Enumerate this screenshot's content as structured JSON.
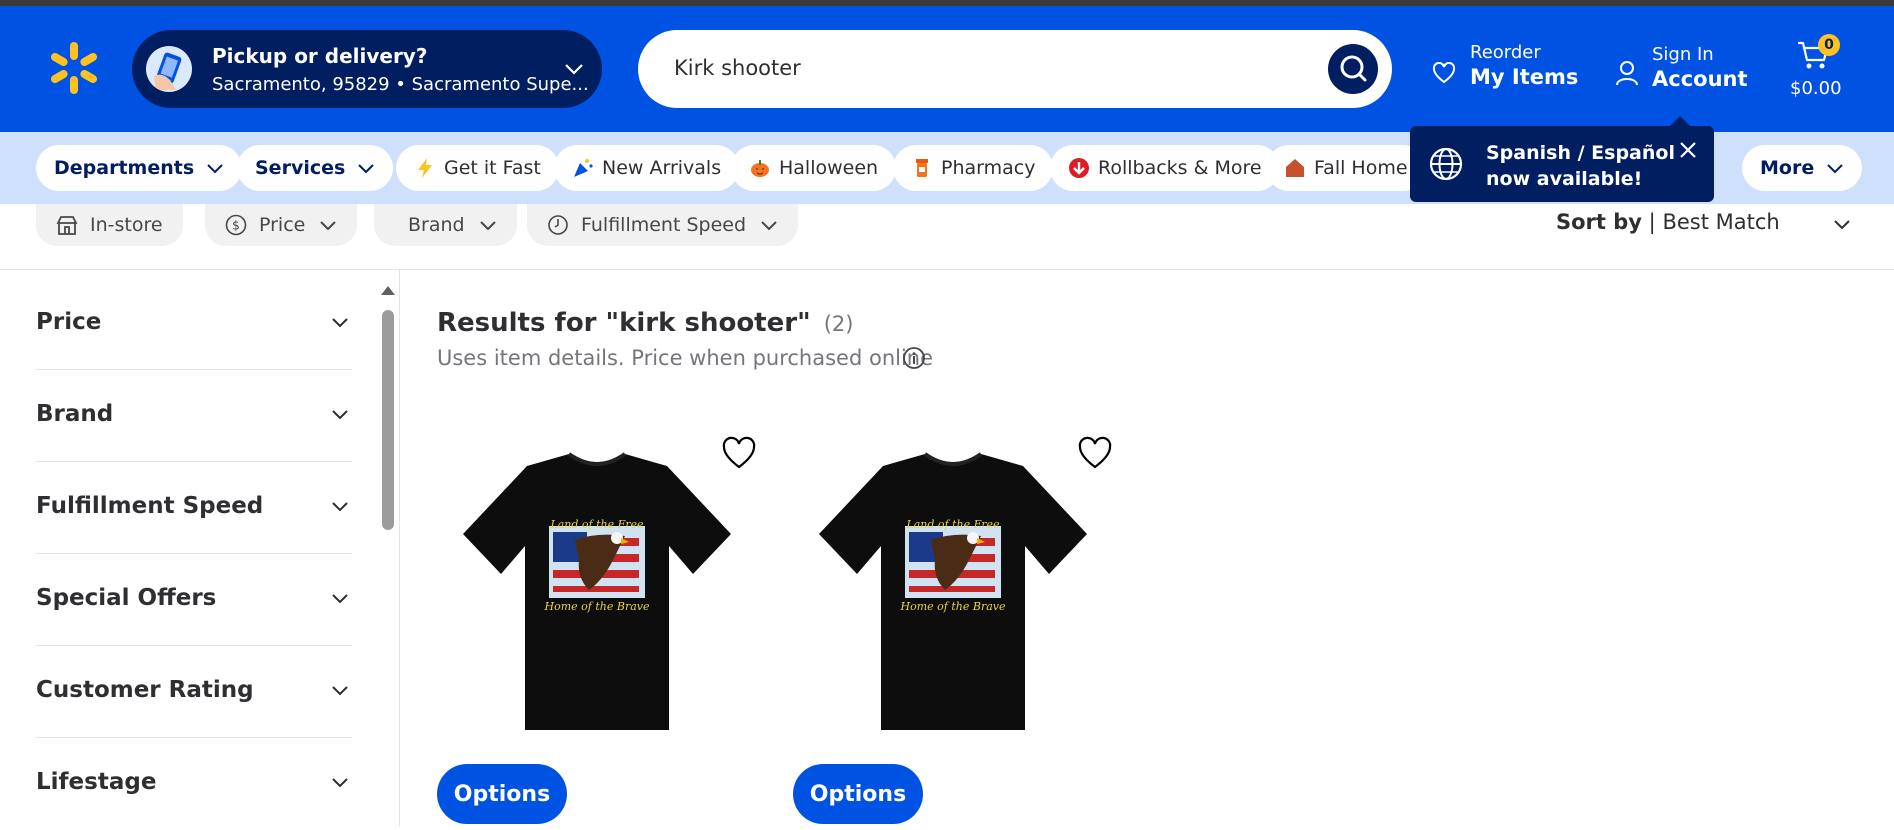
{
  "header": {
    "logo_icon": "walmart-spark-icon",
    "pickup_title": "Pickup or delivery?",
    "pickup_location": "Sacramento, 95829 • Sacramento Supe...",
    "search_value": "Kirk shooter",
    "reorder_small": "Reorder",
    "reorder_big": "My Items",
    "signin_small": "Sign In",
    "signin_big": "Account",
    "cart_count": "0",
    "cart_total": "$0.00",
    "brand_color": "#0053e2",
    "accent_color": "#ffc220"
  },
  "nav": {
    "items": [
      {
        "label": "Departments"
      },
      {
        "label": "Services"
      },
      {
        "label": "Get it Fast"
      },
      {
        "label": "New Arrivals"
      },
      {
        "label": "Halloween"
      },
      {
        "label": "Pharmacy"
      },
      {
        "label": "Rollbacks & More"
      },
      {
        "label": "Fall Home"
      },
      {
        "label": "More"
      }
    ]
  },
  "tooltip": {
    "line1": "Spanish / Español",
    "line2": "now available!"
  },
  "filters": {
    "chips": [
      {
        "label": "In-store"
      },
      {
        "label": "Price"
      },
      {
        "label": "Brand"
      },
      {
        "label": "Fulfillment Speed"
      }
    ],
    "sort_label": "Sort by",
    "sort_value": "Best Match"
  },
  "sidebar": {
    "facets": [
      {
        "label": "Price"
      },
      {
        "label": "Brand"
      },
      {
        "label": "Fulfillment Speed"
      },
      {
        "label": "Special Offers"
      },
      {
        "label": "Customer Rating"
      },
      {
        "label": "Lifestage"
      }
    ]
  },
  "results": {
    "title": "Results for \"kirk shooter\"",
    "count": "(2)",
    "subtitle": "Uses item details. Price when purchased online",
    "products": [
      {
        "button": "Options"
      },
      {
        "button": "Options"
      }
    ]
  }
}
